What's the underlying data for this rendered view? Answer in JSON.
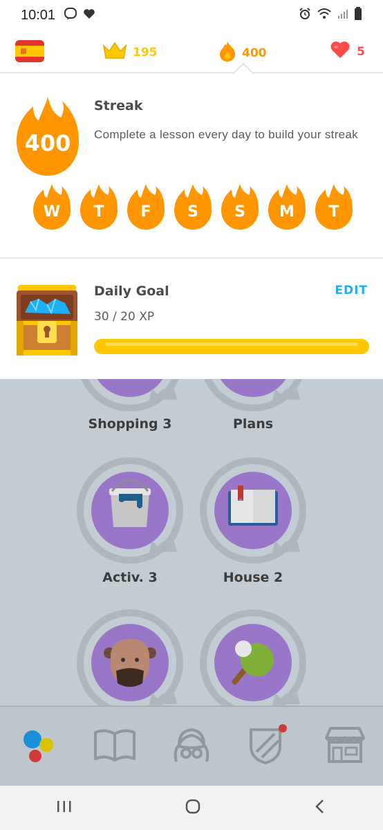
{
  "status_bar": {
    "time": "10:01"
  },
  "stats": {
    "crowns": "195",
    "streak": "400",
    "hearts": "5"
  },
  "streak": {
    "count": "400",
    "title": "Streak",
    "description": "Complete a lesson every day to build your streak",
    "days": [
      "W",
      "T",
      "F",
      "S",
      "S",
      "M",
      "T"
    ]
  },
  "daily_goal": {
    "title": "Daily Goal",
    "progress_text": "30 / 20 XP",
    "edit_label": "EDIT",
    "progress_fraction": 1.0
  },
  "skills": [
    {
      "name": "Shopping 3",
      "icon": "shopping-icon"
    },
    {
      "name": "Plans",
      "icon": "plans-icon"
    },
    {
      "name": "Activ. 3",
      "icon": "paint-bucket-icon"
    },
    {
      "name": "House 2",
      "icon": "book-icon"
    },
    {
      "name": "",
      "icon": "person-icon"
    },
    {
      "name": "",
      "icon": "ping-pong-icon"
    }
  ],
  "bottom_nav": [
    "learn-icon",
    "stories-icon",
    "profile-icon",
    "leagues-icon",
    "shop-icon"
  ],
  "colors": {
    "orange": "#ff9600",
    "gold": "#ffc800",
    "red": "#ff4b4b",
    "blue": "#1cb0f6",
    "dim_purple": "#9a76c9",
    "dim_bg": "#c2ccd2"
  }
}
